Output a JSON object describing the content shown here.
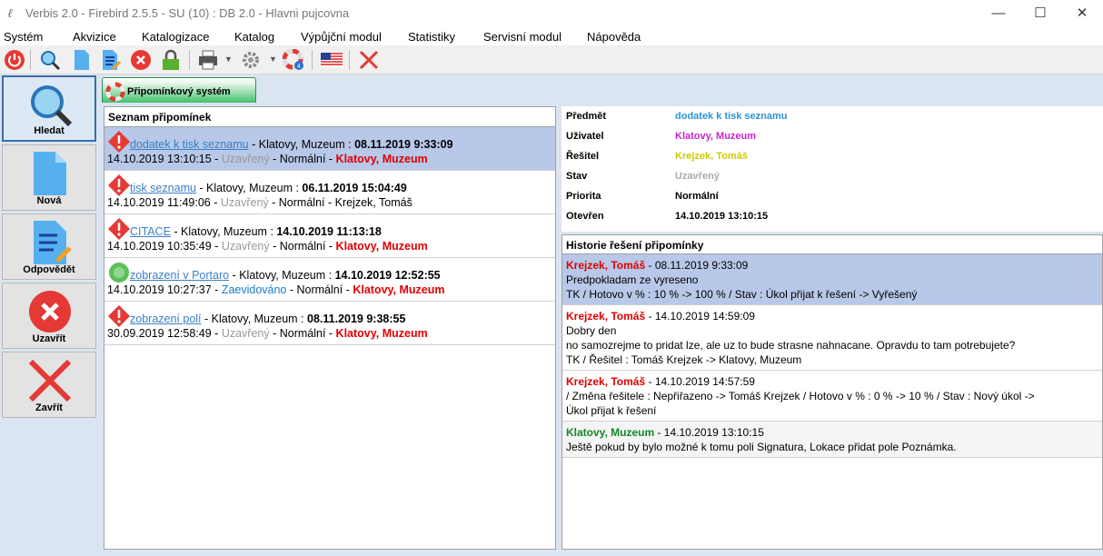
{
  "window": {
    "title": "Verbis 2.0 - Firebird 2.5.5 - SU (10) : DB 2.0 - Hlavni pujcovna"
  },
  "menu": [
    "Systém",
    "Akvizice",
    "Katalogizace",
    "Katalog",
    "Výpůjční modul",
    "Statistiky",
    "Servisní modul",
    "Nápověda"
  ],
  "toolbar_icons": [
    "power-icon",
    "search-icon",
    "new-doc-icon",
    "edit-icon",
    "cancel-icon",
    "lock-icon",
    "print-icon",
    "gear-icon",
    "lifebuoy-icon",
    "us-flag-icon",
    "close-icon"
  ],
  "left": {
    "search": "Hledat",
    "new": "Nová",
    "reply": "Odpovědět",
    "close_item": "Uzavřít",
    "exit": "Zavřít"
  },
  "tab": {
    "label": "Připomínkový systém"
  },
  "list": {
    "header": "Seznam připomínek",
    "items": [
      {
        "subject": "dodatek k tisk seznamu",
        "from": " - Klatovy, Muzeum : ",
        "date": "08.11.2019 9:33:09",
        "opened": "14.10.2019 13:10:15",
        "sep1": " - ",
        "state": "Uzavřený",
        "prio": " - Normální - ",
        "solver": "Klatovy, Muzeum",
        "icon": "alert"
      },
      {
        "subject": "tisk seznamu",
        "from": " - Klatovy, Muzeum : ",
        "date": "06.11.2019 15:04:49",
        "opened": "14.10.2019 11:49:06",
        "sep1": " - ",
        "state": "Uzavřený",
        "prio": " - Normální - ",
        "solver": "Krejzek, Tomáš",
        "icon": "alert"
      },
      {
        "subject": "CITACE",
        "from": " - Klatovy, Muzeum : ",
        "date": "14.10.2019 11:13:18",
        "opened": "14.10.2019 10:35:49",
        "sep1": " - ",
        "state": "Uzavřený",
        "prio": " - Normální - ",
        "solver": "Klatovy, Muzeum",
        "icon": "alert"
      },
      {
        "subject": "zobrazení v Portaro",
        "from": " - Klatovy, Muzeum : ",
        "date": "14.10.2019 12:52:55",
        "opened": "14.10.2019 10:27:37",
        "sep1": " - ",
        "state": "Zaevidováno",
        "prio": " - Normální - ",
        "solver": "Klatovy, Muzeum",
        "icon": "ok"
      },
      {
        "subject": "zobrazení polí",
        "from": " - Klatovy, Muzeum : ",
        "date": "08.11.2019 9:38:55",
        "opened": "30.09.2019 12:58:49",
        "sep1": " - ",
        "state": "Uzavřený",
        "prio": " - Normální - ",
        "solver": "Klatovy, Muzeum",
        "icon": "alert"
      }
    ]
  },
  "detail": {
    "labels": {
      "subject": "Předmět",
      "user": "Uživatel",
      "solver": "Řešitel",
      "state": "Stav",
      "priority": "Priorita",
      "opened": "Otevřen"
    },
    "values": {
      "subject": "dodatek k tisk seznamu",
      "user": "Klatovy, Muzeum",
      "solver": "Krejzek, Tomáš",
      "state": "Uzavřený",
      "priority": "Normální",
      "opened": "14.10.2019 13:10:15"
    },
    "colors": {
      "subject": "#2b95d6",
      "user": "#cc22cc",
      "solver": "#cccc00",
      "state": "#aaaaaa"
    }
  },
  "history": {
    "header": "Historie řešení připomínky",
    "entries": [
      {
        "author": "Krejzek, Tomáš",
        "date": " - 08.11.2019 9:33:09",
        "lines": [
          "Predpokladam ze vyreseno",
          "TK / Hotovo v % : 10 % -> 100 % / Stav : Úkol přijat k řešení -> Vyřešený"
        ]
      },
      {
        "author": "Krejzek, Tomáš",
        "date": " - 14.10.2019 14:59:09",
        "lines": [
          "Dobry den",
          "no samozrejme to pridat lze, ale uz to bude strasne nahnacane. Opravdu to tam potrebujete?",
          "TK / Řešitel : Tomáš Krejzek -> Klatovy, Muzeum"
        ]
      },
      {
        "author": "Krejzek, Tomáš",
        "date": " - 14.10.2019 14:57:59",
        "lines": [
          "/ Změna řešitele : Nepřiřazeno -> Tomáš Krejzek / Hotovo v % : 0 % -> 10 % / Stav : Nový úkol ->",
          "Úkol přijat k řešení"
        ]
      },
      {
        "author": "Klatovy, Muzeum",
        "date": " - 14.10.2019 13:10:15",
        "lines": [
          "Ještě pokud by bylo možné k tomu poli Signatura, Lokace přidat pole Poznámka."
        ]
      }
    ]
  }
}
